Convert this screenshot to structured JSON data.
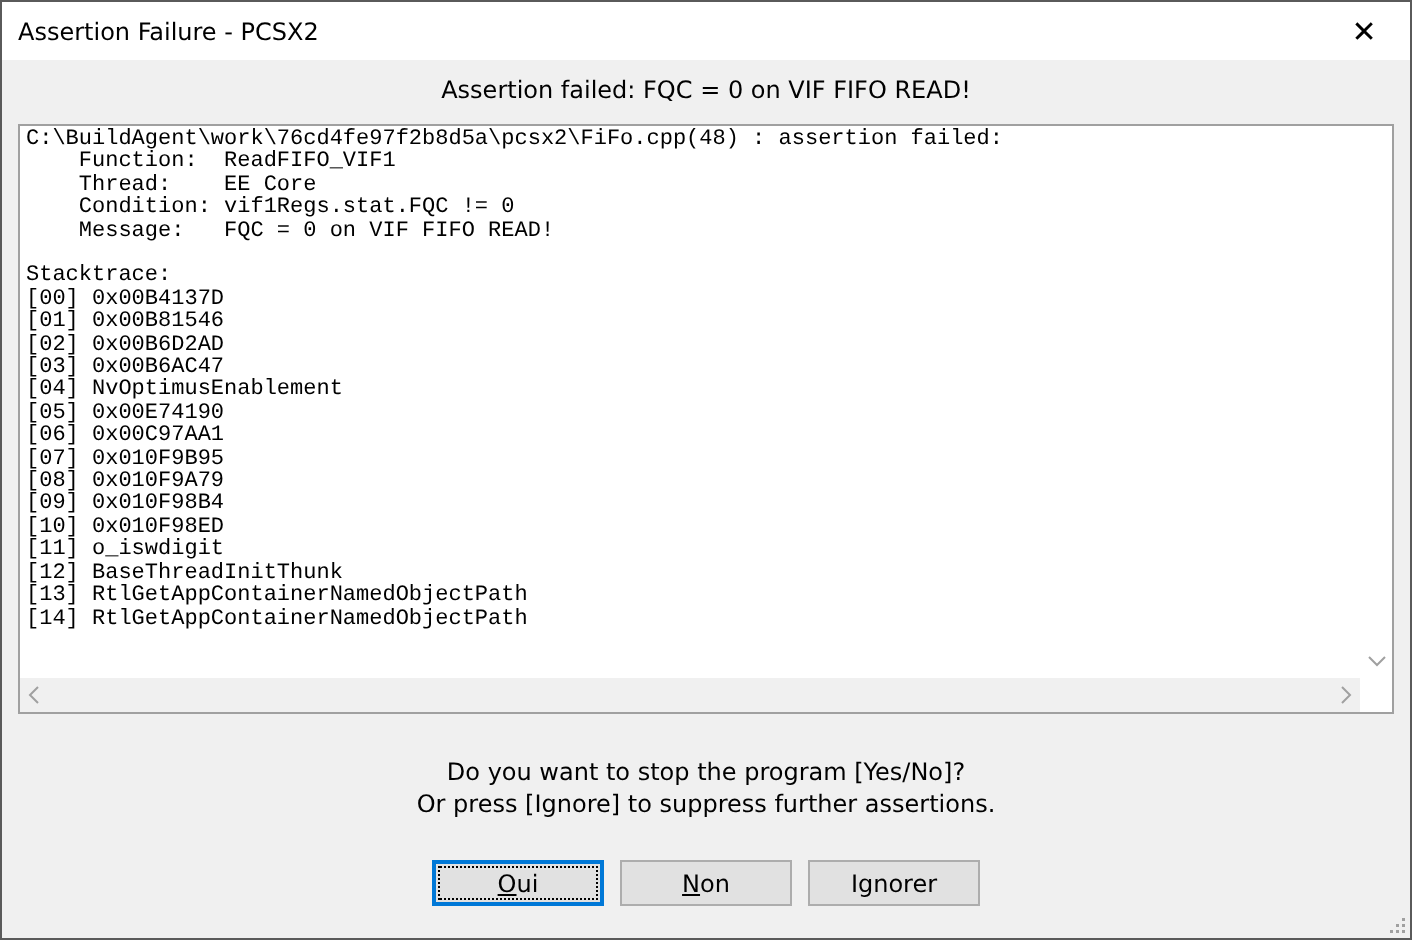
{
  "window": {
    "title": "Assertion Failure - PCSX2",
    "close": "✕"
  },
  "header": "Assertion failed: FQC = 0 on VIF FIFO READ!",
  "log": [
    [
      "C:\\BuildAgent\\work\\76cd4fe97f2b8d5a\\pcsx2\\FiFo.cpp(48) : assertion failed:",
      "    Function:  ReadFIFO_VIF1",
      "    Thread:    EE Core",
      "    Condition: vif1Regs.stat.FQC != 0",
      "    Message:   FQC = 0 on VIF FIFO READ!"
    ],
    [
      "Stacktrace:",
      "[00] 0x00B4137D",
      "[01] 0x00B81546",
      "[02] 0x00B6D2AD",
      "[03] 0x00B6AC47",
      "[04] NvOptimusEnablement",
      "[05] 0x00E74190",
      "[06] 0x00C97AA1",
      "[07] 0x010F9B95",
      "[08] 0x010F9A79",
      "[09] 0x010F98B4",
      "[10] 0x010F98ED",
      "[11] o_iswdigit",
      "[12] BaseThreadInitThunk",
      "[13] RtlGetAppContainerNamedObjectPath",
      "[14] RtlGetAppContainerNamedObjectPath"
    ]
  ],
  "prompt": [
    "Do you want to stop the program [Yes/No]?",
    "Or press [Ignore] to suppress further assertions."
  ],
  "buttons": [
    {
      "label": "Oui",
      "default": true,
      "mnemonic": true
    },
    {
      "label": "Non",
      "default": false,
      "mnemonic": true
    },
    {
      "label": "Ignorer",
      "default": false,
      "mnemonic": false
    }
  ]
}
